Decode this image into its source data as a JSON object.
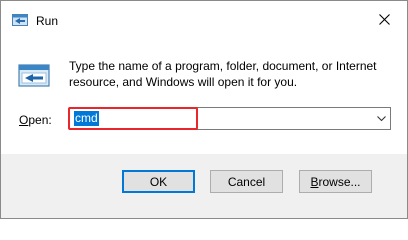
{
  "window": {
    "title": "Run",
    "icon": "run-app-icon",
    "close_icon": "close-icon"
  },
  "description": "Type the name of a program, folder, document, or Internet resource, and Windows will open it for you.",
  "open_field": {
    "label_mnemonic": "O",
    "label_rest": "pen:",
    "value": "cmd",
    "dropdown_icon": "chevron-down-icon",
    "highlight_color": "#e8262b",
    "selection_color": "#0078d7"
  },
  "buttons": {
    "ok": "OK",
    "cancel": "Cancel",
    "browse_mnemonic": "B",
    "browse_rest": "rowse..."
  }
}
